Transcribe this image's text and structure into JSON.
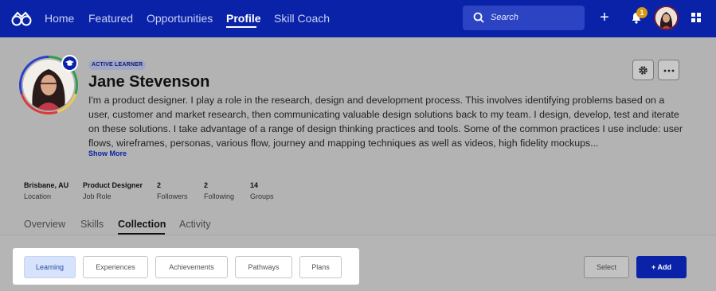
{
  "nav": {
    "items": [
      "Home",
      "Featured",
      "Opportunities",
      "Profile",
      "Skill Coach"
    ],
    "active": "Profile",
    "search_placeholder": "Search",
    "notification_count": "1",
    "brand_color": "#0a22a8"
  },
  "profile": {
    "badge": "ACTIVE LEARNER",
    "name": "Jane Stevenson",
    "bio": "I'm a product designer. I play a role in the research, design and development process. This involves identifying problems based on a user, customer and market research, then communicating valuable design solutions back to my team. I design, develop, test and iterate on these solutions. I take advantage of a range of design thinking practices and tools. Some of the common practices I use include: user flows, wireframes, personas, various flow, journey and mapping techniques as well as videos, high fidelity mockups...",
    "show_more": "Show More"
  },
  "stats": [
    {
      "value": "Brisbane, AU",
      "label": "Location"
    },
    {
      "value": "Product Designer",
      "label": "Job Role"
    },
    {
      "value": "2",
      "label": "Followers"
    },
    {
      "value": "2",
      "label": "Following"
    },
    {
      "value": "14",
      "label": "Groups"
    }
  ],
  "tabs": [
    "Overview",
    "Skills",
    "Collection",
    "Activity"
  ],
  "active_tab": "Collection",
  "collection": {
    "filters": [
      "Learning",
      "Experiences",
      "Achievements",
      "Pathways",
      "Plans"
    ],
    "active_filter": "Learning",
    "select_label": "Select",
    "add_label": "+ Add"
  }
}
